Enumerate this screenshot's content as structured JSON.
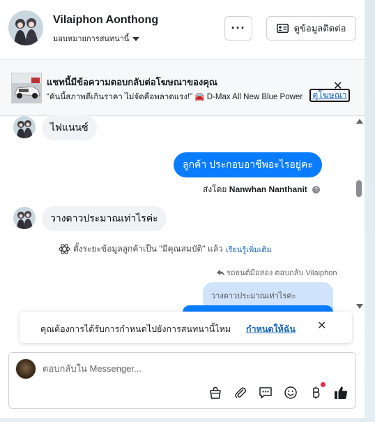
{
  "header": {
    "name": "Vilaiphon Aonthong",
    "assign_label": "มอบหมายการสนทนานี้",
    "more_label": "···",
    "contact_label": "ดูข้อมูลติดต่อ"
  },
  "ad": {
    "title": "แชทนี้มีข้อความตอบกลับต่อโฆษณาของคุณ",
    "description": "“คันนี้สภาพดีเกินราคา ไม่จัดคือพลาดแรง!” 🚘 D-Max All New Blue Power",
    "link_label": "ดูโฆษณา"
  },
  "messages": {
    "m1": "ไฟแนนซ์",
    "m2": "ลูกค้า  ประกอบอาชีพอะไรอยู่คะ",
    "sent_by_prefix": "ส่งโดย",
    "sent_by_name": "Nanwhan Nanthanit",
    "m3": "วางดาวประมาณเท่าไรค่ะ",
    "system_note": "ตั้งระยะข้อมูลลูกค้าเป็น \"มีคุณสมบัติ\" แล้ว",
    "system_link": "เรียนรู้เพิ่มเติม",
    "reply_meta": "รถยนต์มือสอง ตอบกลับ Vilaiphon",
    "quoted": "วางดาวประมาณเท่าไรค่ะ"
  },
  "toast": {
    "text": "คุณต้องการได้รับการกำหนดไปยังการสนทนานี้ไหม",
    "link": "กำหนดให้ฉัน"
  },
  "composer": {
    "placeholder": "ตอบกลับใน Messenger..."
  },
  "colors": {
    "accent": "#0a7cff",
    "link": "#1565c0",
    "badge": "#f02849"
  }
}
